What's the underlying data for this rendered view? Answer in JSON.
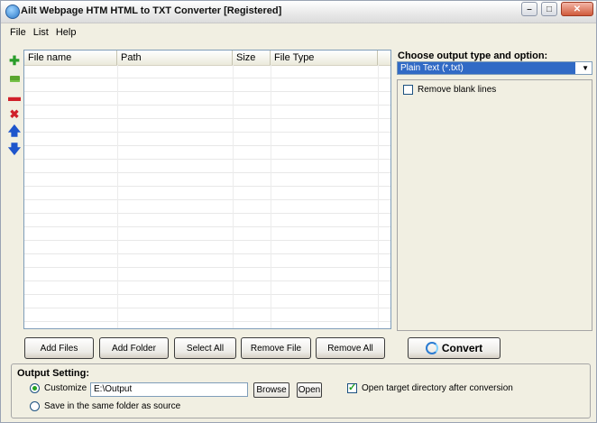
{
  "window": {
    "title": "Ailt Webpage HTM HTML to TXT Converter [Registered]",
    "controls": {
      "minimize": "–",
      "maximize": "□",
      "close": "✕"
    }
  },
  "menu": [
    "File",
    "List",
    "Help"
  ],
  "toolbar_icons": [
    "add-file-icon",
    "add-folder-icon",
    "remove-icon",
    "delete-icon",
    "move-up-icon",
    "move-down-icon"
  ],
  "file_list": {
    "columns": [
      "File name",
      "Path",
      "Size",
      "File Type"
    ],
    "rows": []
  },
  "output_type": {
    "label": "Choose output type and option:",
    "selected": "Plain Text (*.txt)"
  },
  "options": {
    "remove_blank_lines": {
      "label": "Remove blank lines",
      "checked": false
    }
  },
  "buttons": {
    "add_files": "Add Files",
    "add_folder": "Add Folder",
    "select_all": "Select All",
    "remove_file": "Remove File",
    "remove_all": "Remove All",
    "convert": "Convert"
  },
  "output_setting": {
    "title": "Output Setting:",
    "customize_label": "Customize",
    "path": "E:\\Output",
    "browse": "Browse",
    "open": "Open",
    "open_after_label": "Open target directory after conversion",
    "open_after_checked": true,
    "same_folder_label": "Save in the same folder as source",
    "selected_mode": "customize"
  }
}
